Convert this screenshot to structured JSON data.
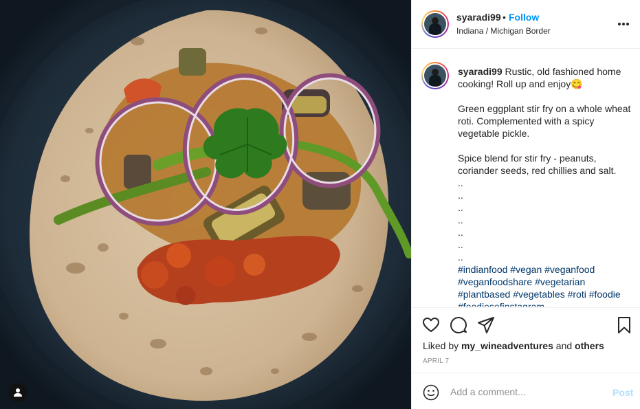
{
  "post": {
    "username": "syaradi99",
    "separator": "•",
    "follow_label": "Follow",
    "location": "Indiana / Michigan Border",
    "more_icon": "more-options-icon"
  },
  "caption": {
    "username": "syaradi99",
    "line1": "Rustic, old fashioned home cooking! Roll up and enjoy",
    "emoji": "😋",
    "para2": "Green eggplant stir fry on a whole wheat roti. Complemented with a spicy vegetable pickle.",
    "para3": "Spice blend for stir fry - peanuts, coriander seeds, red chillies and salt.",
    "dots": [
      "..",
      "..",
      "..",
      "..",
      "..",
      "..",
      ".."
    ],
    "hashtags": [
      "#indianfood",
      "#vegan",
      "#veganfood",
      "#veganfoodshare",
      "#vegetarian",
      "#plantbased",
      "#vegetables",
      "#roti",
      "#foodie",
      "#foodiesofinstagram"
    ]
  },
  "actions": {
    "icons": [
      "heart-icon",
      "comment-icon",
      "share-icon",
      "bookmark-icon"
    ],
    "liked_by_prefix": "Liked by",
    "liked_by_user": "my_wineadventures",
    "liked_by_and": "and",
    "liked_by_others": "others",
    "date": "APRIL 7"
  },
  "comment": {
    "placeholder": "Add a comment...",
    "post_label": "Post"
  },
  "colors": {
    "accent_blue": "#0095f6",
    "hashtag": "#00376b",
    "post_disabled": "#b2dffc",
    "muted": "#8e8e8e"
  }
}
